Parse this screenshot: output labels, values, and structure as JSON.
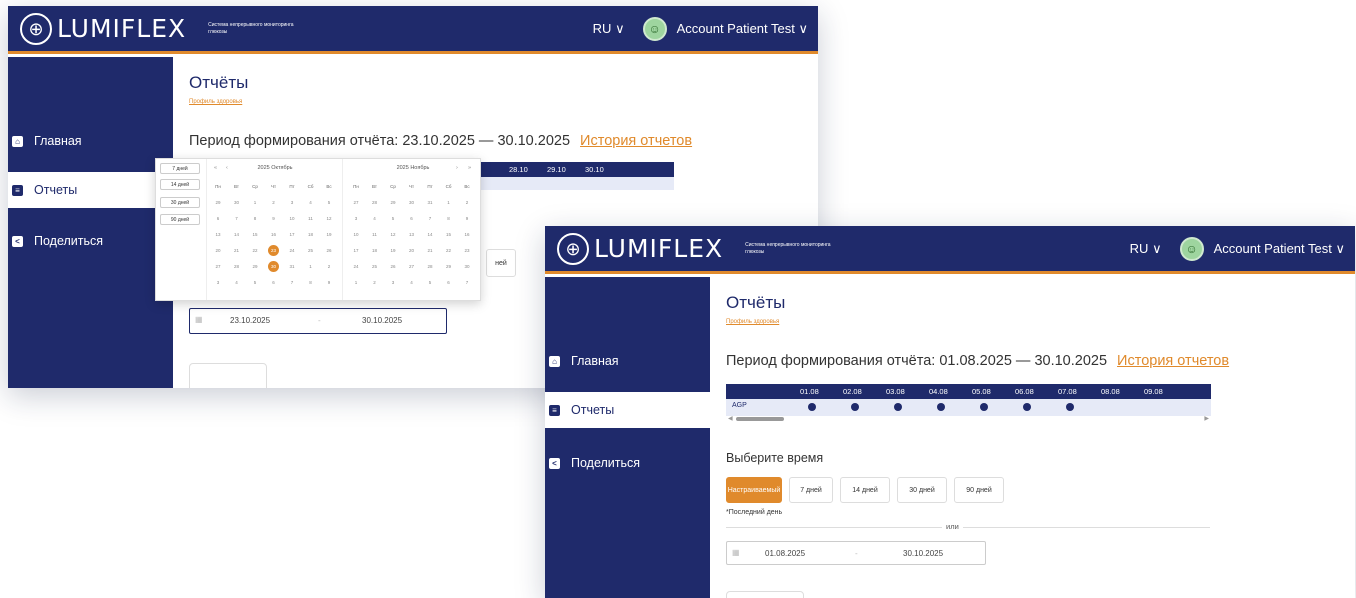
{
  "brand": {
    "name": "LUMIFLEX",
    "tagline": "Система непрерывного мониторинга глюкозы"
  },
  "header": {
    "language": "RU",
    "account_name": "Account Patient Test"
  },
  "sidebar": {
    "items": [
      {
        "label": "Главная",
        "icon": "home-icon"
      },
      {
        "label": "Отчеты",
        "icon": "report-icon"
      },
      {
        "label": "Поделиться",
        "icon": "share-icon"
      }
    ]
  },
  "colors": {
    "navy": "#1f2a6b",
    "accent": "#e08a2c"
  },
  "back_window": {
    "page_title": "Отчёты",
    "profile_link": "Профиль здоровья",
    "period_label": "Период формирования отчёта: 23.10.2025 — 30.10.2025",
    "history_link": "История отчетов",
    "agp_dates": [
      "28.10",
      "29.10",
      "30.10"
    ],
    "partial_chip": "ней",
    "range_start": "23.10.2025",
    "range_sep": "-",
    "range_end": "30.10.2025",
    "datepicker": {
      "presets": [
        "7 дней",
        "14 дней",
        "30 дней",
        "90 дней"
      ],
      "weekdays": [
        "Пн",
        "Вт",
        "Ср",
        "Чт",
        "Пт",
        "Сб",
        "Вс"
      ],
      "left_month": {
        "title": "2025 Октябрь",
        "prev_year": "«",
        "prev_month": "‹",
        "days": [
          "29",
          "30",
          "1",
          "2",
          "3",
          "4",
          "5",
          "6",
          "7",
          "8",
          "9",
          "10",
          "11",
          "12",
          "13",
          "14",
          "15",
          "16",
          "17",
          "18",
          "19",
          "20",
          "21",
          "22",
          "23",
          "24",
          "25",
          "26",
          "27",
          "28",
          "29",
          "30",
          "31",
          "1",
          "2",
          "3",
          "4",
          "5",
          "6",
          "7",
          "8",
          "9"
        ],
        "selected": [
          "23",
          "30"
        ]
      },
      "right_month": {
        "title": "2025 Ноябрь",
        "next_month": "›",
        "next_year": "»",
        "days": [
          "27",
          "28",
          "29",
          "30",
          "31",
          "1",
          "2",
          "3",
          "4",
          "5",
          "6",
          "7",
          "8",
          "9",
          "10",
          "11",
          "12",
          "13",
          "14",
          "15",
          "16",
          "17",
          "18",
          "19",
          "20",
          "21",
          "22",
          "23",
          "24",
          "25",
          "26",
          "27",
          "28",
          "29",
          "30",
          "1",
          "2",
          "3",
          "4",
          "5",
          "6",
          "7"
        ]
      }
    }
  },
  "front_window": {
    "page_title": "Отчёты",
    "profile_link": "Профиль здоровья",
    "period_label": "Период формирования отчёта: 01.08.2025 — 30.10.2025",
    "history_link": "История отчетов",
    "agp_dates": [
      "01.08",
      "02.08",
      "03.08",
      "04.08",
      "05.08",
      "06.08",
      "07.08",
      "08.08",
      "09.08"
    ],
    "agp_label": "AGP",
    "agp_dot_count": 7,
    "select_time_title": "Выберите время",
    "time_options": [
      "Настраиваемый",
      "7 дней",
      "14 дней",
      "30 дней",
      "90 дней"
    ],
    "last_day_note": "*Последний день",
    "or_text": "или",
    "range_start": "01.08.2025",
    "range_sep": "-",
    "range_end": "30.10.2025"
  }
}
